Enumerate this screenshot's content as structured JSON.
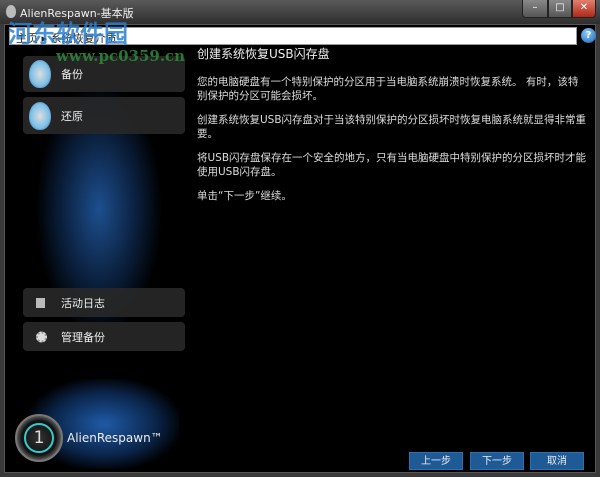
{
  "window": {
    "title": "AlienRespawn-基本版",
    "minimize": "–",
    "maximize": "□",
    "close": "✕"
  },
  "breadcrumb": {
    "text": "主页 ▸ 系统恢复介质"
  },
  "help": "?",
  "sidebar": {
    "items": [
      {
        "label": "备份"
      },
      {
        "label": "还原"
      },
      {
        "label": "活动日志"
      },
      {
        "label": "管理备份"
      }
    ],
    "brand": "AlienRespawn™",
    "brand_number": "1"
  },
  "content": {
    "title": "创建系统恢复USB闪存盘",
    "paragraphs": [
      "您的电脑硬盘有一个特别保护的分区用于当电脑系统崩溃时恢复系统。 有时，该特别保护的分区可能会损坏。",
      "创建系统恢复USB闪存盘对于当该特别保护的分区损坏时恢复电脑系统就显得非常重要。",
      "将USB闪存盘保存在一个安全的地方，只有当电脑硬盘中特别保护的分区损坏时才能使用USB闪存盘。",
      "单击“下一步”继续。"
    ]
  },
  "buttons": {
    "back": "上一步",
    "next": "下一步",
    "cancel": "取消"
  },
  "watermark": {
    "name": "河东软件园",
    "url": "www.pc0359.cn"
  }
}
